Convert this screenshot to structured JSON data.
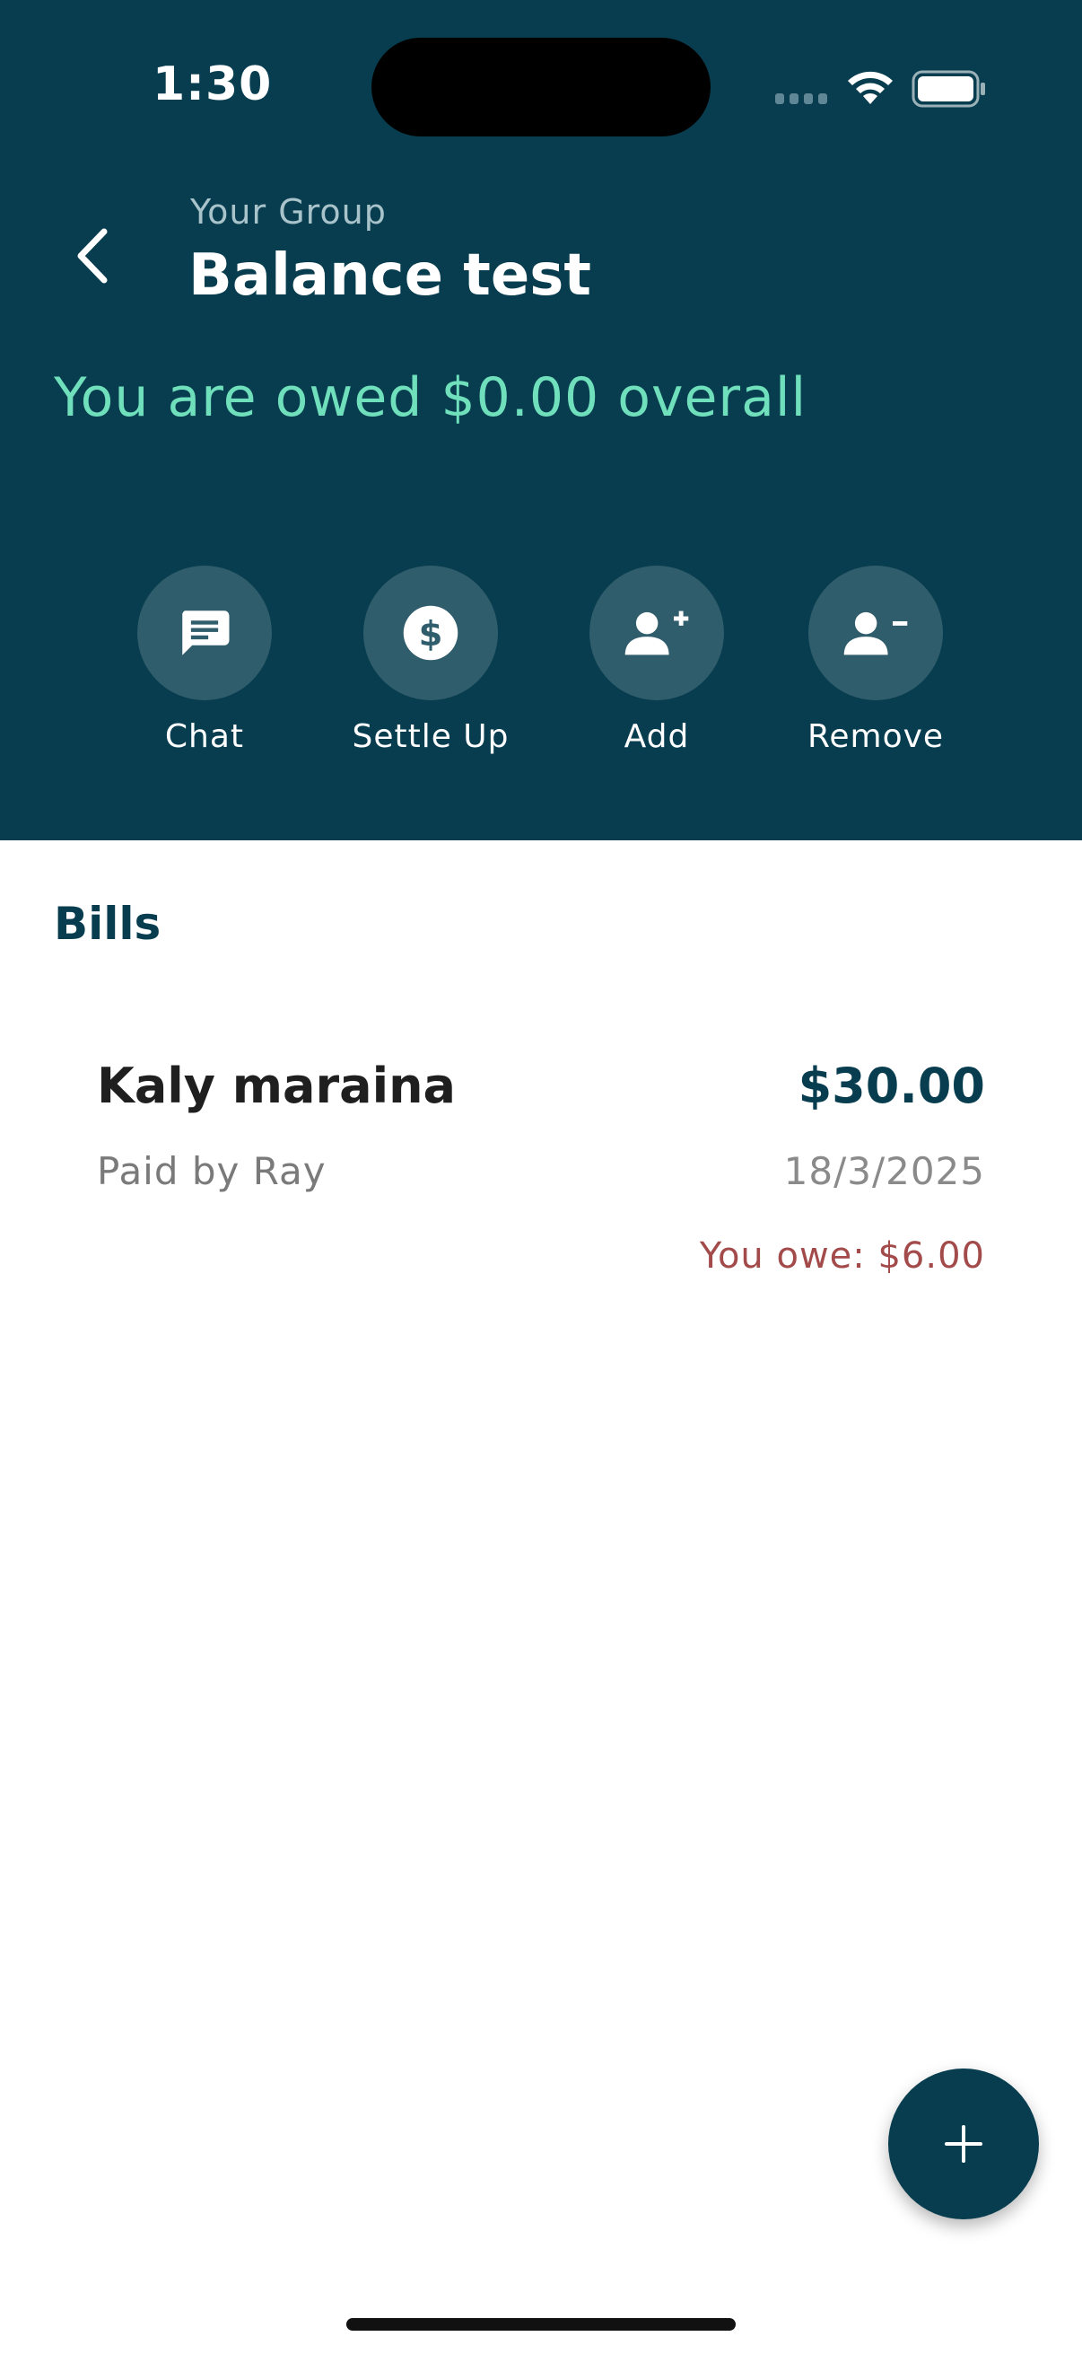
{
  "status_bar": {
    "time": "1:30"
  },
  "header": {
    "group_label": "Your Group",
    "group_name": "Balance test",
    "balance_text": "You are owed $0.00 overall",
    "background_color": "#073d4f",
    "balance_color": "#6fe0bb"
  },
  "actions": [
    {
      "label": "Chat",
      "icon": "chat-icon"
    },
    {
      "label": "Settle Up",
      "icon": "dollar-icon"
    },
    {
      "label": "Add",
      "icon": "add-person-icon"
    },
    {
      "label": "Remove",
      "icon": "remove-person-icon"
    }
  ],
  "bills": {
    "title": "Bills",
    "items": [
      {
        "name": "Kaly maraina",
        "amount": "$30.00",
        "paid_by": "Paid by Ray",
        "date": "18/3/2025",
        "you_owe": "You owe: $6.00"
      }
    ]
  },
  "fab": {
    "icon": "plus-icon"
  }
}
